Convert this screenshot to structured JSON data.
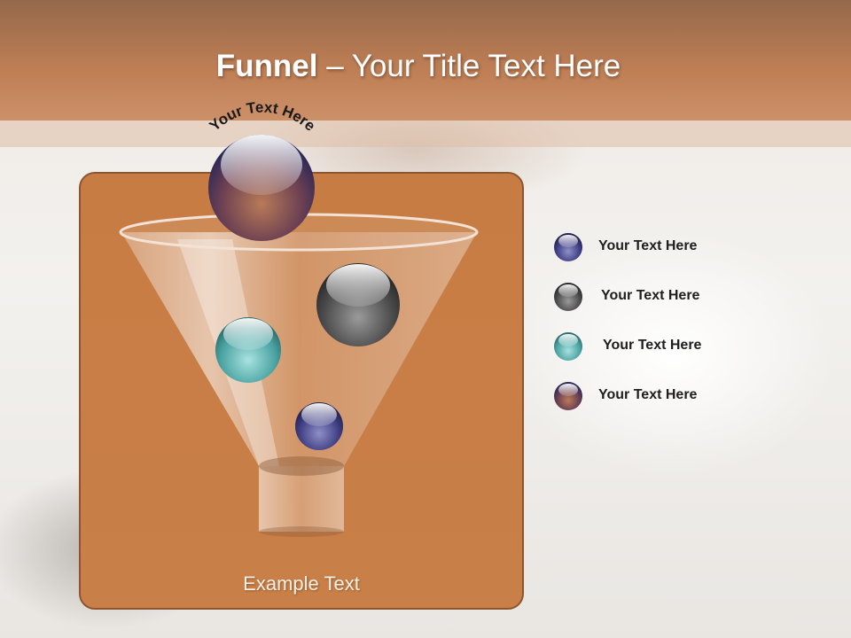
{
  "slide": {
    "title_bold": "Funnel",
    "title_rest": " – Your Title Text Here",
    "arc_text": "Your Text Here",
    "panel_caption": "Example Text"
  },
  "legend": [
    {
      "label": "Your  Text Here",
      "ball_color": "#4b4a8c"
    },
    {
      "label": "Your  Text Here",
      "ball_color": "#4d4d4d"
    },
    {
      "label": "Your  Text Here",
      "ball_color": "#4aa3a2"
    },
    {
      "label": "Your  Text Here",
      "ball_color": "#7a4a3c"
    }
  ],
  "colors": {
    "header": "#c07f55",
    "panel": "#c77c44",
    "panel_border": "#8b5530"
  }
}
